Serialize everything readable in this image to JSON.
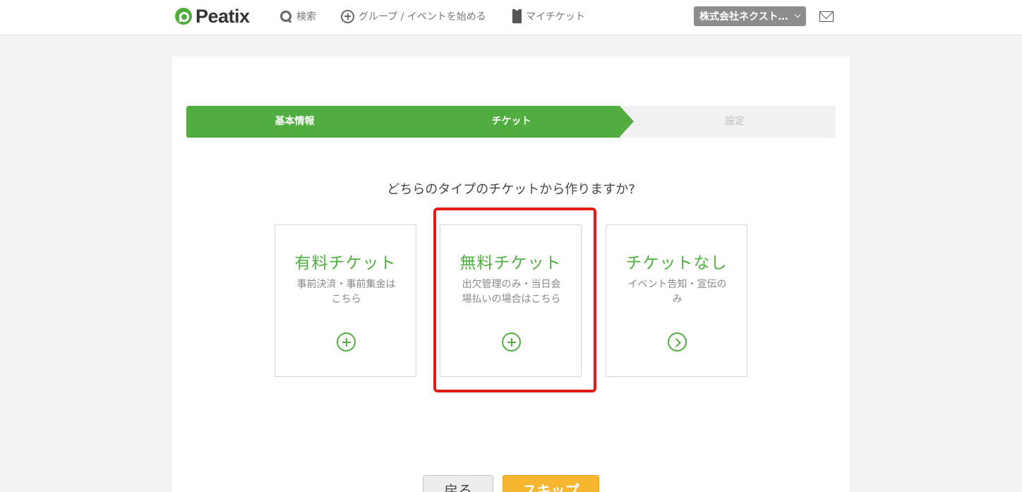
{
  "header": {
    "logo_text": "Peatix",
    "nav": {
      "search": "検索",
      "start_group_event": "グループ / イベントを始める",
      "my_ticket": "マイチケット"
    },
    "account_label": "株式会社ネクスト…",
    "icons": {
      "search": "search-icon",
      "start": "plus-circle-icon",
      "ticket": "ticket-icon",
      "account_menu": "chevron-down-icon",
      "mail": "mail-icon"
    }
  },
  "steps": [
    {
      "label": "基本情報",
      "state": "done"
    },
    {
      "label": "チケット",
      "state": "current"
    },
    {
      "label": "設定",
      "state": "upcoming"
    }
  ],
  "question": "どちらのタイプのチケットから作りますか?",
  "options": [
    {
      "title": "有料チケット",
      "description": "事前決済・事前集金はこちら",
      "icon": "plus-circle-icon"
    },
    {
      "title": "無料チケット",
      "description": "出欠管理のみ・当日会場払いの場合はこちら",
      "icon": "plus-circle-icon"
    },
    {
      "title": "チケットなし",
      "description": "イベント告知・宣伝のみ",
      "icon": "chevron-right-circle-icon"
    }
  ],
  "buttons": {
    "back": "戻る",
    "skip": "スキップ"
  },
  "colors": {
    "brand_green": "#52ad41",
    "highlight_red": "#e31a14",
    "skip_orange": "#f6b630"
  }
}
